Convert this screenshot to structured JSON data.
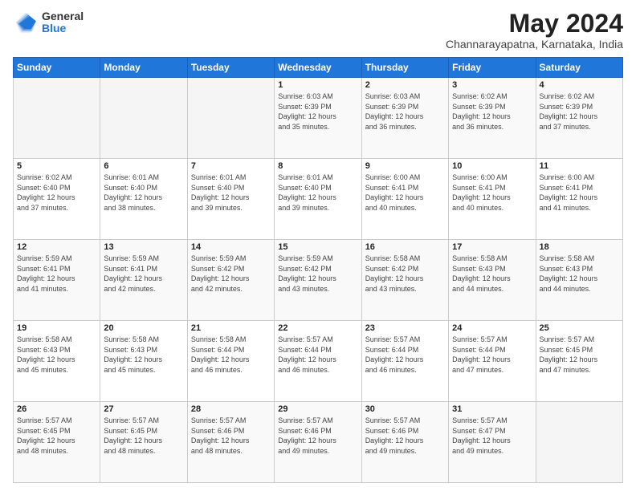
{
  "logo": {
    "general": "General",
    "blue": "Blue"
  },
  "title": {
    "month": "May 2024",
    "location": "Channarayapatna, Karnataka, India"
  },
  "weekdays": [
    "Sunday",
    "Monday",
    "Tuesday",
    "Wednesday",
    "Thursday",
    "Friday",
    "Saturday"
  ],
  "weeks": [
    [
      {
        "day": "",
        "info": ""
      },
      {
        "day": "",
        "info": ""
      },
      {
        "day": "",
        "info": ""
      },
      {
        "day": "1",
        "info": "Sunrise: 6:03 AM\nSunset: 6:39 PM\nDaylight: 12 hours\nand 35 minutes."
      },
      {
        "day": "2",
        "info": "Sunrise: 6:03 AM\nSunset: 6:39 PM\nDaylight: 12 hours\nand 36 minutes."
      },
      {
        "day": "3",
        "info": "Sunrise: 6:02 AM\nSunset: 6:39 PM\nDaylight: 12 hours\nand 36 minutes."
      },
      {
        "day": "4",
        "info": "Sunrise: 6:02 AM\nSunset: 6:39 PM\nDaylight: 12 hours\nand 37 minutes."
      }
    ],
    [
      {
        "day": "5",
        "info": "Sunrise: 6:02 AM\nSunset: 6:40 PM\nDaylight: 12 hours\nand 37 minutes."
      },
      {
        "day": "6",
        "info": "Sunrise: 6:01 AM\nSunset: 6:40 PM\nDaylight: 12 hours\nand 38 minutes."
      },
      {
        "day": "7",
        "info": "Sunrise: 6:01 AM\nSunset: 6:40 PM\nDaylight: 12 hours\nand 39 minutes."
      },
      {
        "day": "8",
        "info": "Sunrise: 6:01 AM\nSunset: 6:40 PM\nDaylight: 12 hours\nand 39 minutes."
      },
      {
        "day": "9",
        "info": "Sunrise: 6:00 AM\nSunset: 6:41 PM\nDaylight: 12 hours\nand 40 minutes."
      },
      {
        "day": "10",
        "info": "Sunrise: 6:00 AM\nSunset: 6:41 PM\nDaylight: 12 hours\nand 40 minutes."
      },
      {
        "day": "11",
        "info": "Sunrise: 6:00 AM\nSunset: 6:41 PM\nDaylight: 12 hours\nand 41 minutes."
      }
    ],
    [
      {
        "day": "12",
        "info": "Sunrise: 5:59 AM\nSunset: 6:41 PM\nDaylight: 12 hours\nand 41 minutes."
      },
      {
        "day": "13",
        "info": "Sunrise: 5:59 AM\nSunset: 6:41 PM\nDaylight: 12 hours\nand 42 minutes."
      },
      {
        "day": "14",
        "info": "Sunrise: 5:59 AM\nSunset: 6:42 PM\nDaylight: 12 hours\nand 42 minutes."
      },
      {
        "day": "15",
        "info": "Sunrise: 5:59 AM\nSunset: 6:42 PM\nDaylight: 12 hours\nand 43 minutes."
      },
      {
        "day": "16",
        "info": "Sunrise: 5:58 AM\nSunset: 6:42 PM\nDaylight: 12 hours\nand 43 minutes."
      },
      {
        "day": "17",
        "info": "Sunrise: 5:58 AM\nSunset: 6:43 PM\nDaylight: 12 hours\nand 44 minutes."
      },
      {
        "day": "18",
        "info": "Sunrise: 5:58 AM\nSunset: 6:43 PM\nDaylight: 12 hours\nand 44 minutes."
      }
    ],
    [
      {
        "day": "19",
        "info": "Sunrise: 5:58 AM\nSunset: 6:43 PM\nDaylight: 12 hours\nand 45 minutes."
      },
      {
        "day": "20",
        "info": "Sunrise: 5:58 AM\nSunset: 6:43 PM\nDaylight: 12 hours\nand 45 minutes."
      },
      {
        "day": "21",
        "info": "Sunrise: 5:58 AM\nSunset: 6:44 PM\nDaylight: 12 hours\nand 46 minutes."
      },
      {
        "day": "22",
        "info": "Sunrise: 5:57 AM\nSunset: 6:44 PM\nDaylight: 12 hours\nand 46 minutes."
      },
      {
        "day": "23",
        "info": "Sunrise: 5:57 AM\nSunset: 6:44 PM\nDaylight: 12 hours\nand 46 minutes."
      },
      {
        "day": "24",
        "info": "Sunrise: 5:57 AM\nSunset: 6:44 PM\nDaylight: 12 hours\nand 47 minutes."
      },
      {
        "day": "25",
        "info": "Sunrise: 5:57 AM\nSunset: 6:45 PM\nDaylight: 12 hours\nand 47 minutes."
      }
    ],
    [
      {
        "day": "26",
        "info": "Sunrise: 5:57 AM\nSunset: 6:45 PM\nDaylight: 12 hours\nand 48 minutes."
      },
      {
        "day": "27",
        "info": "Sunrise: 5:57 AM\nSunset: 6:45 PM\nDaylight: 12 hours\nand 48 minutes."
      },
      {
        "day": "28",
        "info": "Sunrise: 5:57 AM\nSunset: 6:46 PM\nDaylight: 12 hours\nand 48 minutes."
      },
      {
        "day": "29",
        "info": "Sunrise: 5:57 AM\nSunset: 6:46 PM\nDaylight: 12 hours\nand 49 minutes."
      },
      {
        "day": "30",
        "info": "Sunrise: 5:57 AM\nSunset: 6:46 PM\nDaylight: 12 hours\nand 49 minutes."
      },
      {
        "day": "31",
        "info": "Sunrise: 5:57 AM\nSunset: 6:47 PM\nDaylight: 12 hours\nand 49 minutes."
      },
      {
        "day": "",
        "info": ""
      }
    ]
  ]
}
